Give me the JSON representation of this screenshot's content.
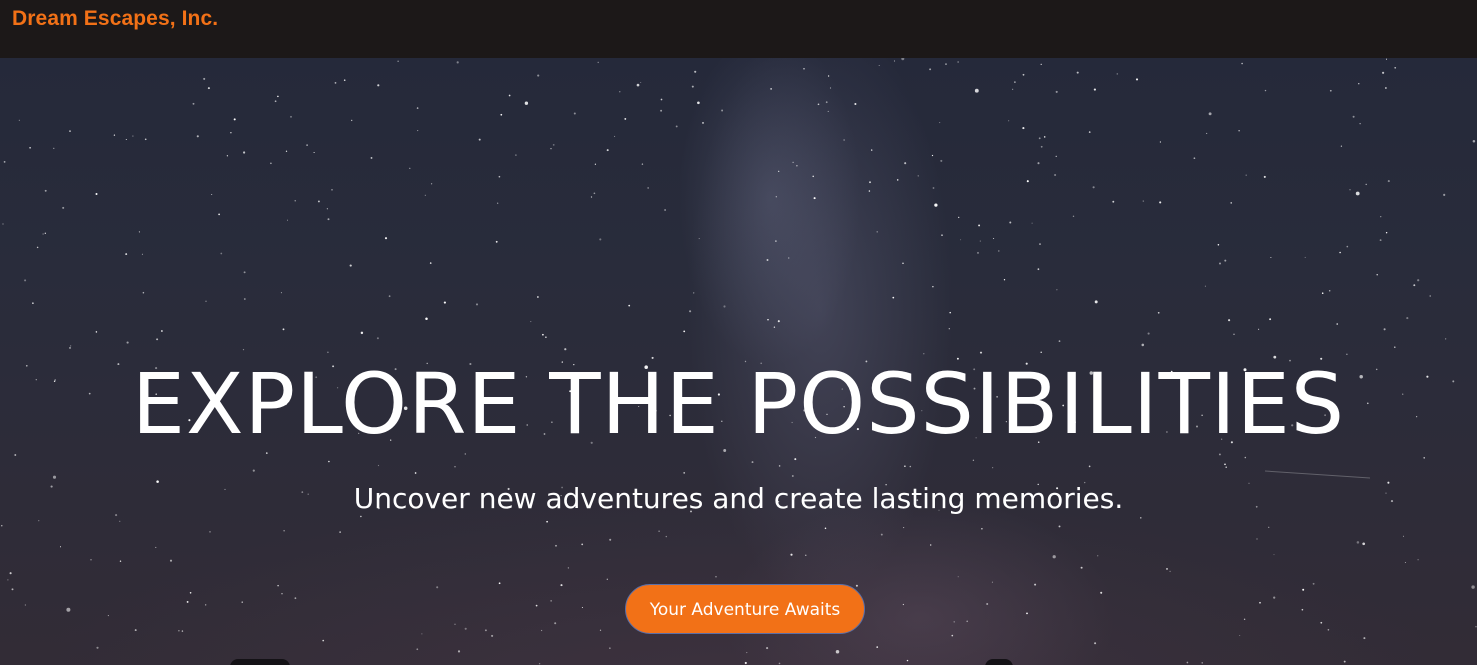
{
  "header": {
    "brand": "Dream Escapes, Inc.",
    "brand_color": "#f27117",
    "background_color": "#1c1818"
  },
  "hero": {
    "background_image": "night-sky-milky-way",
    "title": "EXPLORE THE POSSIBILITIES",
    "subtitle": "Uncover new adventures and create lasting memories.",
    "cta_label": "Your Adventure Awaits",
    "cta_color": "#f27117"
  }
}
